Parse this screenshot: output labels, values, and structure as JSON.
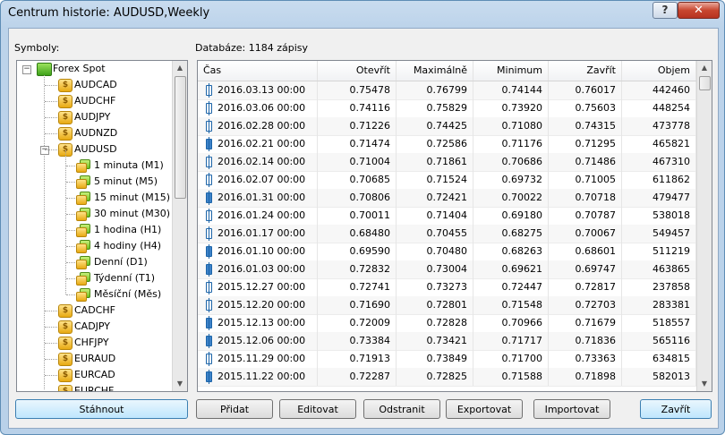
{
  "window": {
    "title": "Centrum historie: AUDUSD,Weekly",
    "help_label": "?",
    "close_label": "✕"
  },
  "labels": {
    "symbols": "Symboly:",
    "database": "Databáze: 1184 zápisy"
  },
  "tree": {
    "root": "Forex Spot",
    "symbols_before": [
      "AUDCAD",
      "AUDCHF",
      "AUDJPY",
      "AUDNZD"
    ],
    "selected": "AUDUSD",
    "timeframes": [
      "1 minuta (M1)",
      "5 minut (M5)",
      "15 minut (M15)",
      "30 minut (M30)",
      "1 hodina (H1)",
      "4 hodiny (H4)",
      "Denní (D1)",
      "Týdenní (T1)",
      "Měsíční (Měs)"
    ],
    "symbols_after": [
      "CADCHF",
      "CADJPY",
      "CHFJPY",
      "EURAUD",
      "EURCAD",
      "EURCHF"
    ]
  },
  "table": {
    "columns": [
      "Čas",
      "Otevřít",
      "Maximálně",
      "Minimum",
      "Zavřít",
      "Objem"
    ],
    "rows": [
      [
        "2016.03.13 00:00",
        "0.75478",
        "0.76799",
        "0.74144",
        "0.76017",
        "442460"
      ],
      [
        "2016.03.06 00:00",
        "0.74116",
        "0.75829",
        "0.73920",
        "0.75603",
        "448254"
      ],
      [
        "2016.02.28 00:00",
        "0.71226",
        "0.74425",
        "0.71080",
        "0.74315",
        "473778"
      ],
      [
        "2016.02.21 00:00",
        "0.71474",
        "0.72586",
        "0.71176",
        "0.71295",
        "465821"
      ],
      [
        "2016.02.14 00:00",
        "0.71004",
        "0.71861",
        "0.70686",
        "0.71486",
        "467310"
      ],
      [
        "2016.02.07 00:00",
        "0.70685",
        "0.71524",
        "0.69732",
        "0.71005",
        "611862"
      ],
      [
        "2016.01.31 00:00",
        "0.70806",
        "0.72421",
        "0.70022",
        "0.70718",
        "479477"
      ],
      [
        "2016.01.24 00:00",
        "0.70011",
        "0.71404",
        "0.69180",
        "0.70787",
        "538018"
      ],
      [
        "2016.01.17 00:00",
        "0.68480",
        "0.70455",
        "0.68275",
        "0.70067",
        "549457"
      ],
      [
        "2016.01.10 00:00",
        "0.69590",
        "0.70480",
        "0.68263",
        "0.68601",
        "511219"
      ],
      [
        "2016.01.03 00:00",
        "0.72832",
        "0.73004",
        "0.69621",
        "0.69747",
        "463865"
      ],
      [
        "2015.12.27 00:00",
        "0.72741",
        "0.73273",
        "0.72447",
        "0.72817",
        "237858"
      ],
      [
        "2015.12.20 00:00",
        "0.71690",
        "0.72801",
        "0.71548",
        "0.72703",
        "283381"
      ],
      [
        "2015.12.13 00:00",
        "0.72009",
        "0.72828",
        "0.70966",
        "0.71679",
        "518557"
      ],
      [
        "2015.12.06 00:00",
        "0.73384",
        "0.73421",
        "0.71717",
        "0.71836",
        "565116"
      ],
      [
        "2015.11.29 00:00",
        "0.71913",
        "0.73849",
        "0.71700",
        "0.73363",
        "634815"
      ],
      [
        "2015.11.22 00:00",
        "0.72287",
        "0.72825",
        "0.71588",
        "0.71898",
        "582013"
      ]
    ]
  },
  "buttons": {
    "download": "Stáhnout",
    "add": "Přidat",
    "edit": "Editovat",
    "remove": "Odstranit",
    "export": "Exportovat",
    "import": "Importovat",
    "close": "Zavřít"
  }
}
